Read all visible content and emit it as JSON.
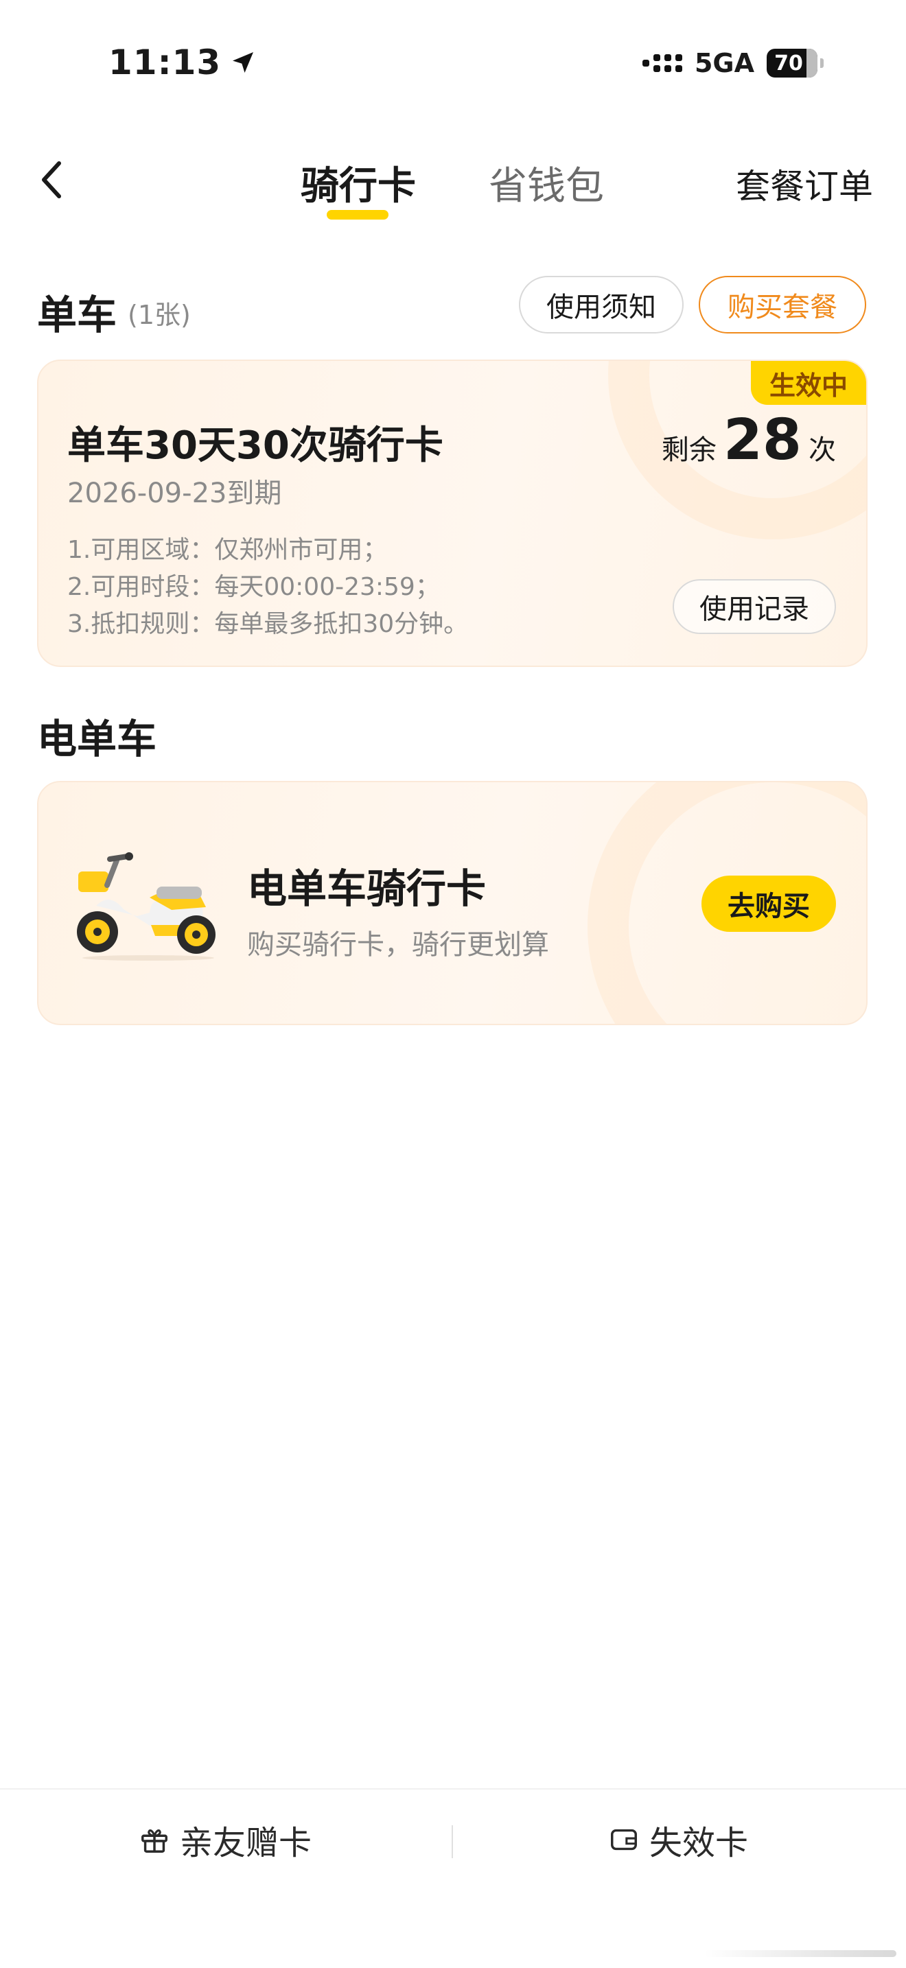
{
  "status": {
    "time": "11:13",
    "network": "5GA",
    "battery": "70"
  },
  "nav": {
    "tabs": [
      {
        "label": "骑行卡",
        "active": true
      },
      {
        "label": "省钱包",
        "active": false
      }
    ],
    "orders": "套餐订单",
    "accent": "#ffd400"
  },
  "bike_section": {
    "title": "单车",
    "count": "(1张)",
    "notice_button": "使用须知",
    "buy_button": "购买套餐",
    "card": {
      "badge": "生效中",
      "name": "单车30天30次骑行卡",
      "expiry": "2026-09-23到期",
      "rules": [
        "1.可用区域：仅郑州市可用；",
        "2.可用时段：每天00:00-23:59；",
        "3.抵扣规则：每单最多抵扣30分钟。"
      ],
      "remain_label": "剩余",
      "remain_value": "28",
      "remain_unit": "次",
      "records_button": "使用记录"
    }
  },
  "ebike_section": {
    "title": "电单车",
    "card": {
      "icon": "scooter-icon",
      "title": "电单车骑行卡",
      "subtitle": "购买骑行卡，骑行更划算",
      "button": "去购买"
    }
  },
  "bottom_bar": {
    "gift": {
      "icon": "gift-icon",
      "label": "亲友赠卡"
    },
    "expired": {
      "icon": "card-icon",
      "label": "失效卡"
    }
  }
}
